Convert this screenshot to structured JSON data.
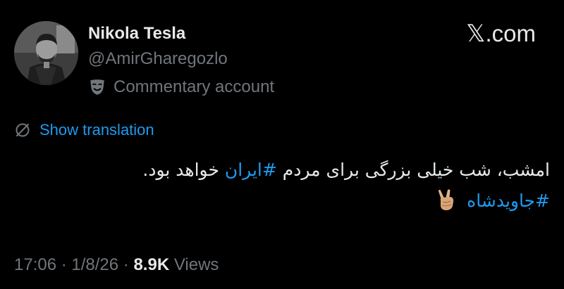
{
  "author": {
    "display_name": "Nikola Tesla",
    "handle": "@AmirGharegozlo",
    "label_icon": "theater-mask-icon",
    "label": "Commentary account"
  },
  "brand": {
    "x_glyph": "𝕏",
    "domain": ".com"
  },
  "translation": {
    "icon": "globe-slash-icon",
    "label": "Show translation"
  },
  "tweet": {
    "line1_before": "امشب، شب خیلی بزرگی برای مردم ",
    "hashtag1": "#ایران",
    "line1_after": " خواهد بود.",
    "hashtag2": "#جاویدشاه",
    "emoji": "victory-hand-emoji"
  },
  "meta": {
    "time": "17:06",
    "separator": " · ",
    "date": "1/8/26",
    "views_count": "8.9K",
    "views_label": "Views"
  },
  "colors": {
    "background": "#000000",
    "text": "#e7e9ea",
    "secondary": "#71767b",
    "link": "#1d9bf0"
  }
}
